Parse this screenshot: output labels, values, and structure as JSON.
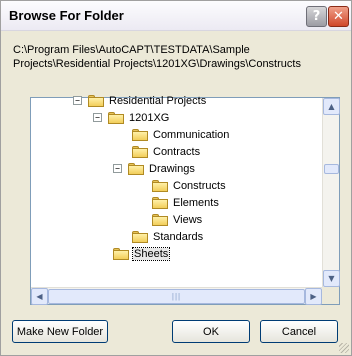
{
  "window": {
    "title": "Browse For Folder",
    "help_glyph": "?",
    "close_glyph": "✕"
  },
  "path": "C:\\Program Files\\AutoCAPT\\TESTDATA\\Sample Projects\\Residential Projects\\1201XG\\Drawings\\Constructs",
  "tree": [
    {
      "label": "Residential  Projects",
      "expander": "−",
      "selected": false
    },
    {
      "label": "1201XG",
      "expander": "−",
      "selected": false
    },
    {
      "label": "Communication",
      "expander": "",
      "selected": false
    },
    {
      "label": "Contracts",
      "expander": "",
      "selected": false
    },
    {
      "label": "Drawings",
      "expander": "−",
      "selected": false
    },
    {
      "label": "Constructs",
      "expander": "",
      "selected": false
    },
    {
      "label": "Elements",
      "expander": "",
      "selected": false
    },
    {
      "label": "Views",
      "expander": "",
      "selected": false
    },
    {
      "label": "Standards",
      "expander": "",
      "selected": false
    },
    {
      "label": "Sheets",
      "expander": "",
      "selected": true
    }
  ],
  "scroll": {
    "up_glyph": "▲",
    "down_glyph": "▼",
    "left_glyph": "◀",
    "right_glyph": "▶",
    "hthumb_grip": "|||"
  },
  "buttons": {
    "make_new_folder": "Make New Folder",
    "ok": "OK",
    "cancel": "Cancel"
  }
}
